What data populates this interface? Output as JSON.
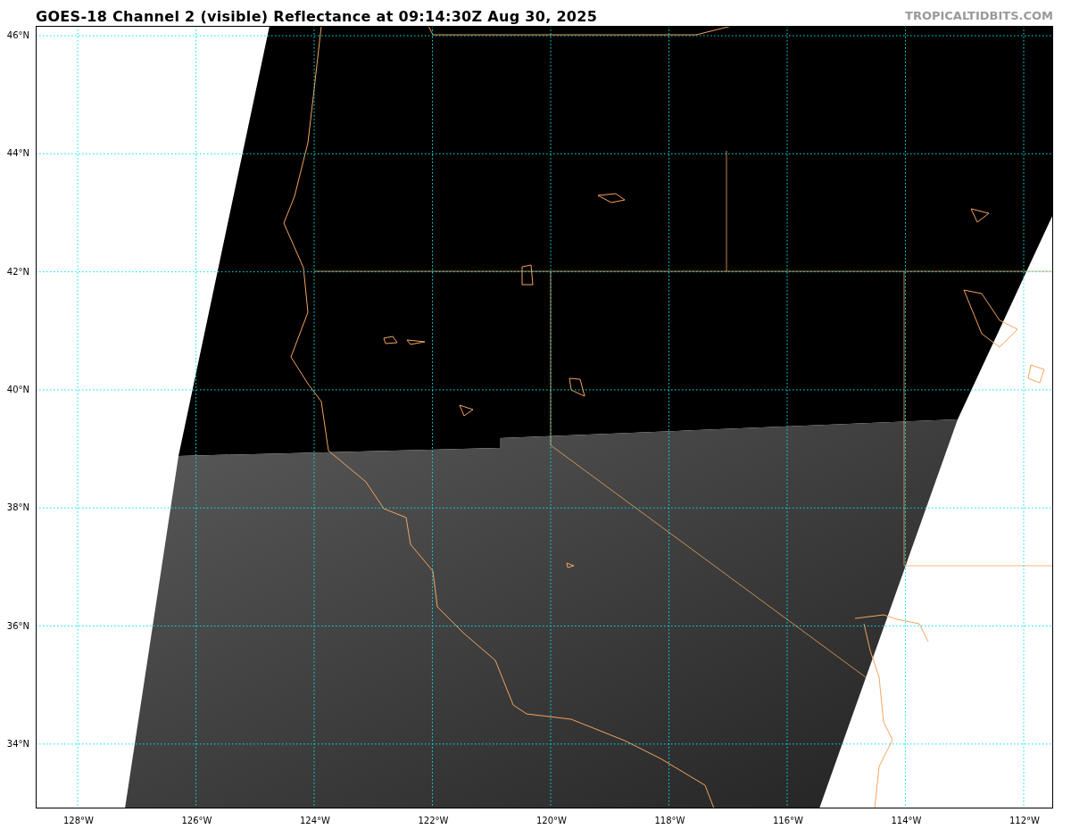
{
  "title": "GOES-18 Channel 2 (visible) Reflectance at 09:14:30Z Aug 30, 2025",
  "site_label": "TROPICALTIDBITS.COM",
  "map": {
    "longitude_labels": [
      "128°W",
      "126°W",
      "124°W",
      "122°W",
      "120°W",
      "118°W",
      "116°W",
      "114°W",
      "112°W"
    ],
    "latitude_labels": [
      "46°N",
      "44°N",
      "42°N",
      "40°N",
      "38°N",
      "36°N",
      "34°N"
    ]
  }
}
